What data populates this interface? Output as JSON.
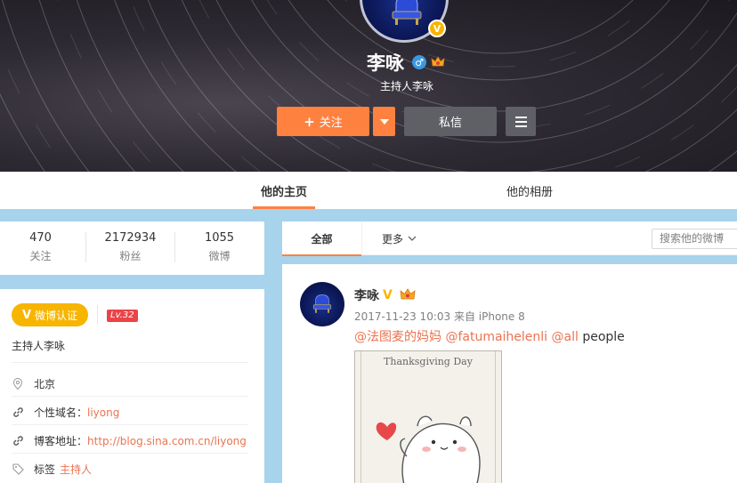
{
  "profile": {
    "name": "李咏",
    "subtitle": "主持人李咏",
    "verified_badge": "V",
    "gender_icon": "♂",
    "follow_label": "关注",
    "message_label": "私信"
  },
  "tabs": [
    {
      "label": "他的主页",
      "active": true
    },
    {
      "label": "他的相册",
      "active": false
    }
  ],
  "stats": [
    {
      "value": "470",
      "label": "关注"
    },
    {
      "value": "2172934",
      "label": "粉丝"
    },
    {
      "value": "1055",
      "label": "微博"
    }
  ],
  "info": {
    "verify_label": "微博认证",
    "verify_mark": "V",
    "level": "Lv.32",
    "description": "主持人李咏",
    "location": "北京",
    "domain_label": "个性域名：",
    "domain_value": "liyong",
    "blog_label": "博客地址：",
    "blog_value": "http://blog.sina.com.cn/liyong",
    "tags_label": "标签",
    "tags_value": "主持人"
  },
  "feed": {
    "tab_all": "全部",
    "tab_more": "更多",
    "search_placeholder": "搜索他的微博"
  },
  "post": {
    "author": "李咏",
    "verified_mark": "V",
    "meta": "2017-11-23 10:03 来自 iPhone 8",
    "mentions": [
      "@法图麦的妈妈",
      "@fatumaihelenli",
      "@all"
    ],
    "text_tail": "people",
    "image_title": "Thanksgiving Day"
  },
  "colors": {
    "accent": "#ff8140",
    "verified": "#f7b500",
    "link": "#eb7350",
    "page_bg": "#a7d3ec"
  }
}
